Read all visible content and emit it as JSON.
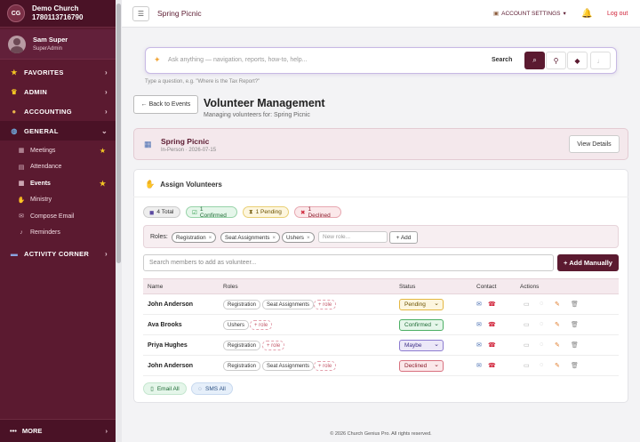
{
  "sidebar": {
    "logo_initials": "CG",
    "church_name": "Demo Church",
    "church_id": "1780113716790",
    "user_name": "Sam Super",
    "user_role": "SuperAdmin",
    "sections": [
      {
        "label": "FAVORITES",
        "icon": "star-icon"
      },
      {
        "label": "ADMIN",
        "icon": "crown-icon"
      },
      {
        "label": "ACCOUNTING",
        "icon": "money-bag-icon"
      },
      {
        "label": "GENERAL",
        "icon": "globe-icon"
      }
    ],
    "general_items": [
      {
        "label": "Meetings",
        "icon": "calendar-icon",
        "starred": true
      },
      {
        "label": "Attendance",
        "icon": "chart-icon",
        "starred": false
      },
      {
        "label": "Events",
        "icon": "calendar-icon",
        "starred": true
      },
      {
        "label": "Ministry",
        "icon": "hands-icon",
        "starred": false
      },
      {
        "label": "Compose Email",
        "icon": "envelope-icon",
        "starred": false
      },
      {
        "label": "Reminders",
        "icon": "bell-icon",
        "starred": false
      }
    ],
    "activity_corner": "ACTIVITY CORNER",
    "more": "MORE"
  },
  "topbar": {
    "menu_icon": "hamburger-icon",
    "page_title": "Spring Picnic",
    "account_settings": "ACCOUNT SETTINGS",
    "logout": "Log out"
  },
  "ai_search": {
    "placeholder": "Ask anything — navigation, reports, how-to, help...",
    "search_label": "Search",
    "hint": "Type a question, e.g. \"Where is the Tax Report?\""
  },
  "page": {
    "back_label": "← Back to Events",
    "title": "Volunteer Management",
    "subtitle": "Managing volunteers for: Spring Picnic"
  },
  "event": {
    "name": "Spring Picnic",
    "meta": "In-Person · 2026-07-15",
    "view_details": "View Details"
  },
  "assign": {
    "heading": "Assign Volunteers",
    "stats": {
      "total": "4 Total",
      "confirmed": "1 Confirmed",
      "pending": "1 Pending",
      "declined": "1 Declined"
    },
    "roles_label": "Roles:",
    "roles": [
      "Registration",
      "Seat Assignments",
      "Ushers"
    ],
    "new_role_placeholder": "New role...",
    "add_label": "+ Add",
    "search_placeholder": "Search members to add as volunteer...",
    "add_manually": "+ Add Manually"
  },
  "table": {
    "headers": {
      "name": "Name",
      "roles": "Roles",
      "status": "Status",
      "contact": "Contact",
      "actions": "Actions"
    },
    "add_role": "+ role",
    "rows": [
      {
        "name": "John Anderson",
        "roles": [
          "Registration",
          "Seat Assignments"
        ],
        "status": "Pending"
      },
      {
        "name": "Ava Brooks",
        "roles": [
          "Ushers"
        ],
        "status": "Confirmed"
      },
      {
        "name": "Priya Hughes",
        "roles": [
          "Registration"
        ],
        "status": "Maybe"
      },
      {
        "name": "John Anderson",
        "roles": [
          "Registration",
          "Seat Assignments"
        ],
        "status": "Declined"
      }
    ]
  },
  "bulk": {
    "email_all": "Email All",
    "sms_all": "SMS All"
  },
  "footer": "© 2026 Church Genius Pro. All rights reserved."
}
